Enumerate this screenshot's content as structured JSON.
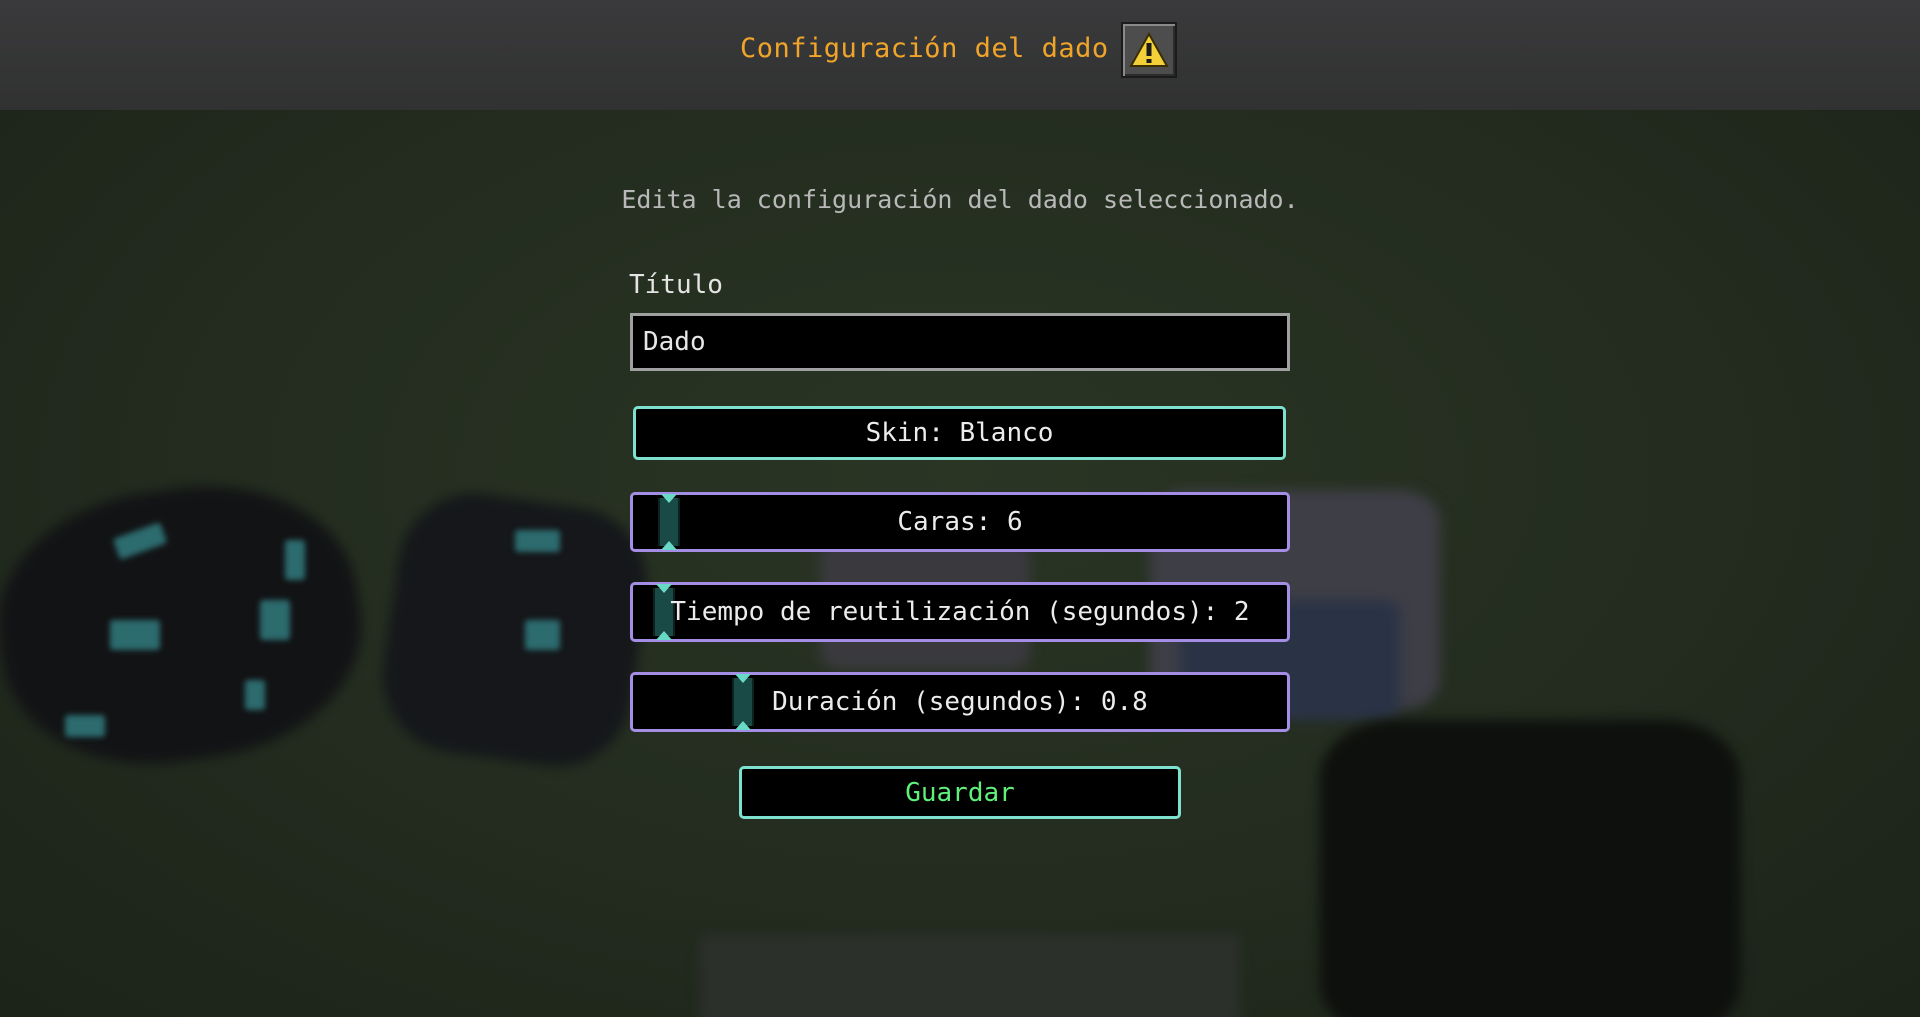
{
  "screen": {
    "title": "Configuración del dado",
    "warning_icon": "warning-triangle-icon",
    "subtitle": "Edita la configuración del dado seleccionado."
  },
  "form": {
    "title_label": "Título",
    "title_value": "Dado",
    "skin_button": "Skin: Blanco",
    "sliders": [
      {
        "label": "Caras: 6",
        "value": 6
      },
      {
        "label": "Tiempo de reutilización (segundos): 2",
        "value": 2
      },
      {
        "label": "Duración (segundos): 0.8",
        "value": 0.8
      }
    ],
    "save_button": "Guardar"
  },
  "colors": {
    "title": "#f0a52a",
    "save_text": "#5ff07a",
    "button_border": "#7ee0cf",
    "slider_border": "#a48de4"
  }
}
